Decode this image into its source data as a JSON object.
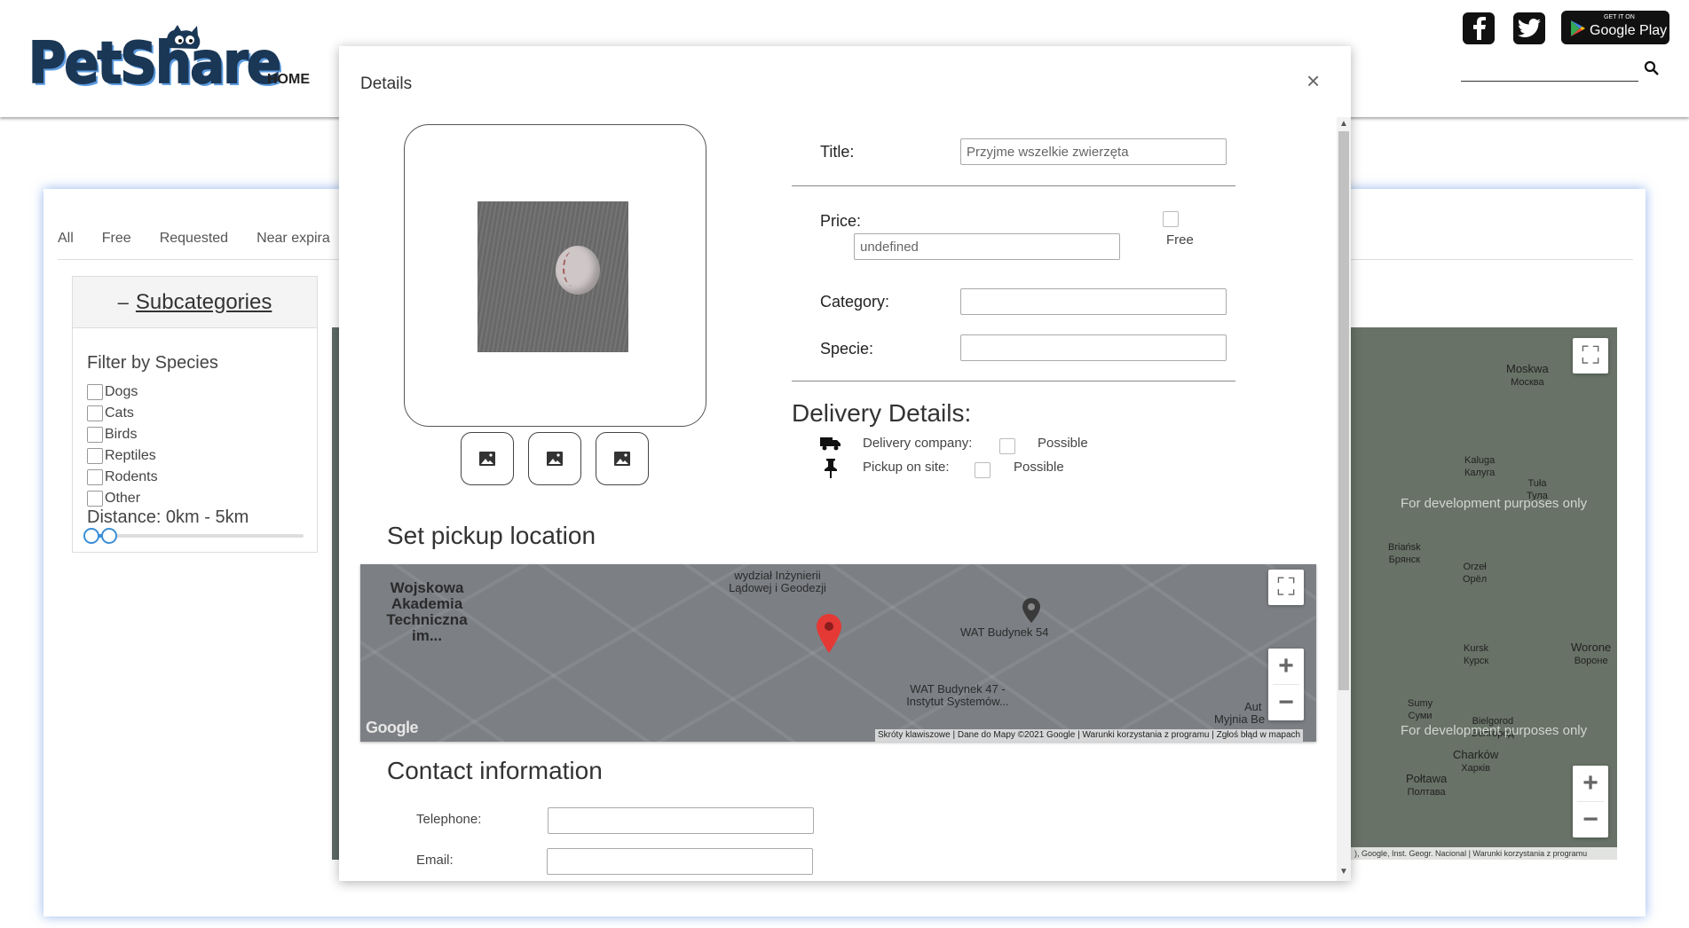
{
  "header": {
    "logo_text": "PetShare",
    "nav_home": "HOME",
    "store_small": "GET IT ON",
    "store_big": "Google Play"
  },
  "background": {
    "tabs": [
      "All",
      "Free",
      "Requested",
      "Near expira"
    ],
    "filter": {
      "title": "Subcategories",
      "toggle": "–",
      "label": "Filter by Species",
      "species": [
        "Dogs",
        "Cats",
        "Birds",
        "Reptiles",
        "Rodents",
        "Other"
      ],
      "distance_label": "Distance: 0km - 5km",
      "distance_min_km": 0,
      "distance_max_km": 5
    },
    "right_map": {
      "cities": [
        {
          "name": "Moskwa",
          "alt": "Москва"
        },
        {
          "name": "Kaluga",
          "alt": "Калуга"
        },
        {
          "name": "Tuła",
          "alt": "Тула"
        },
        {
          "name": "Briańsk",
          "alt": "Брянск"
        },
        {
          "name": "Orzeł",
          "alt": "Орёл"
        },
        {
          "name": "Kursk",
          "alt": "Курск"
        },
        {
          "name": "Worone",
          "alt": "Вороне"
        },
        {
          "name": "Sumy",
          "alt": "Суми"
        },
        {
          "name": "Bielgorod",
          "alt": "Белгород"
        },
        {
          "name": "Charków",
          "alt": "Харків"
        },
        {
          "name": "Połtawa",
          "alt": "Полтава"
        }
      ],
      "dev_text": "For development purposes only",
      "footer": "), Google, Inst. Geogr. Nacional | Warunki korzystania z programu"
    }
  },
  "modal": {
    "title": "Details",
    "close": "×",
    "fields": {
      "title_label": "Title:",
      "title_value": "Przyjme wszelkie zwierzęta",
      "price_label": "Price:",
      "price_value": "undefined",
      "free_label": "Free",
      "category_label": "Category:",
      "category_value": "",
      "specie_label": "Specie:",
      "specie_value": ""
    },
    "delivery": {
      "title": "Delivery Details:",
      "company_label": "Delivery company:",
      "company_option": "Possible",
      "pickup_label": "Pickup on site:",
      "pickup_option": "Possible"
    },
    "pickup": {
      "title": "Set pickup location",
      "map_labels": {
        "wat": "Wojskowa Akademia Techniczna im...",
        "wydzial": "wydział Inżynierii Lądowej i Geodezji",
        "b54": "WAT Budynek 54",
        "b47": "WAT Budynek 47 - Instytut Systemów...",
        "myjnia": "Myjnia Be",
        "aut": "Aut"
      },
      "footer": "Skróty klawiszowe | Dane do Mapy ©2021 Google | Warunki korzystania z programu | Zgłoś błąd w mapach",
      "google": "Google"
    },
    "contact": {
      "title": "Contact information",
      "telephone_label": "Telephone:",
      "telephone_value": "",
      "email_label": "Email:",
      "email_value": ""
    }
  }
}
